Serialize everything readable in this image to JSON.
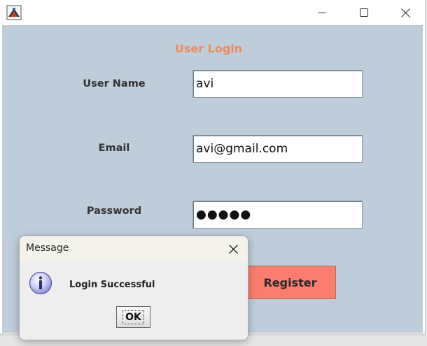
{
  "window": {
    "title": "",
    "icon": "java-app-icon"
  },
  "form": {
    "title": "User Login",
    "username_label": "User Name",
    "username_value": "avi",
    "email_label": "Email",
    "email_value": "avi@gmail.com",
    "password_label": "Password",
    "password_value": "●●●●●",
    "register_label": "Register"
  },
  "dialog": {
    "title": "Message",
    "message": "Login Successful",
    "ok_label": "OK",
    "icon": "information-icon"
  },
  "colors": {
    "panel_bg": "#bfcddb",
    "title_accent": "#f08a5d",
    "register_button": "#fa7d70"
  }
}
